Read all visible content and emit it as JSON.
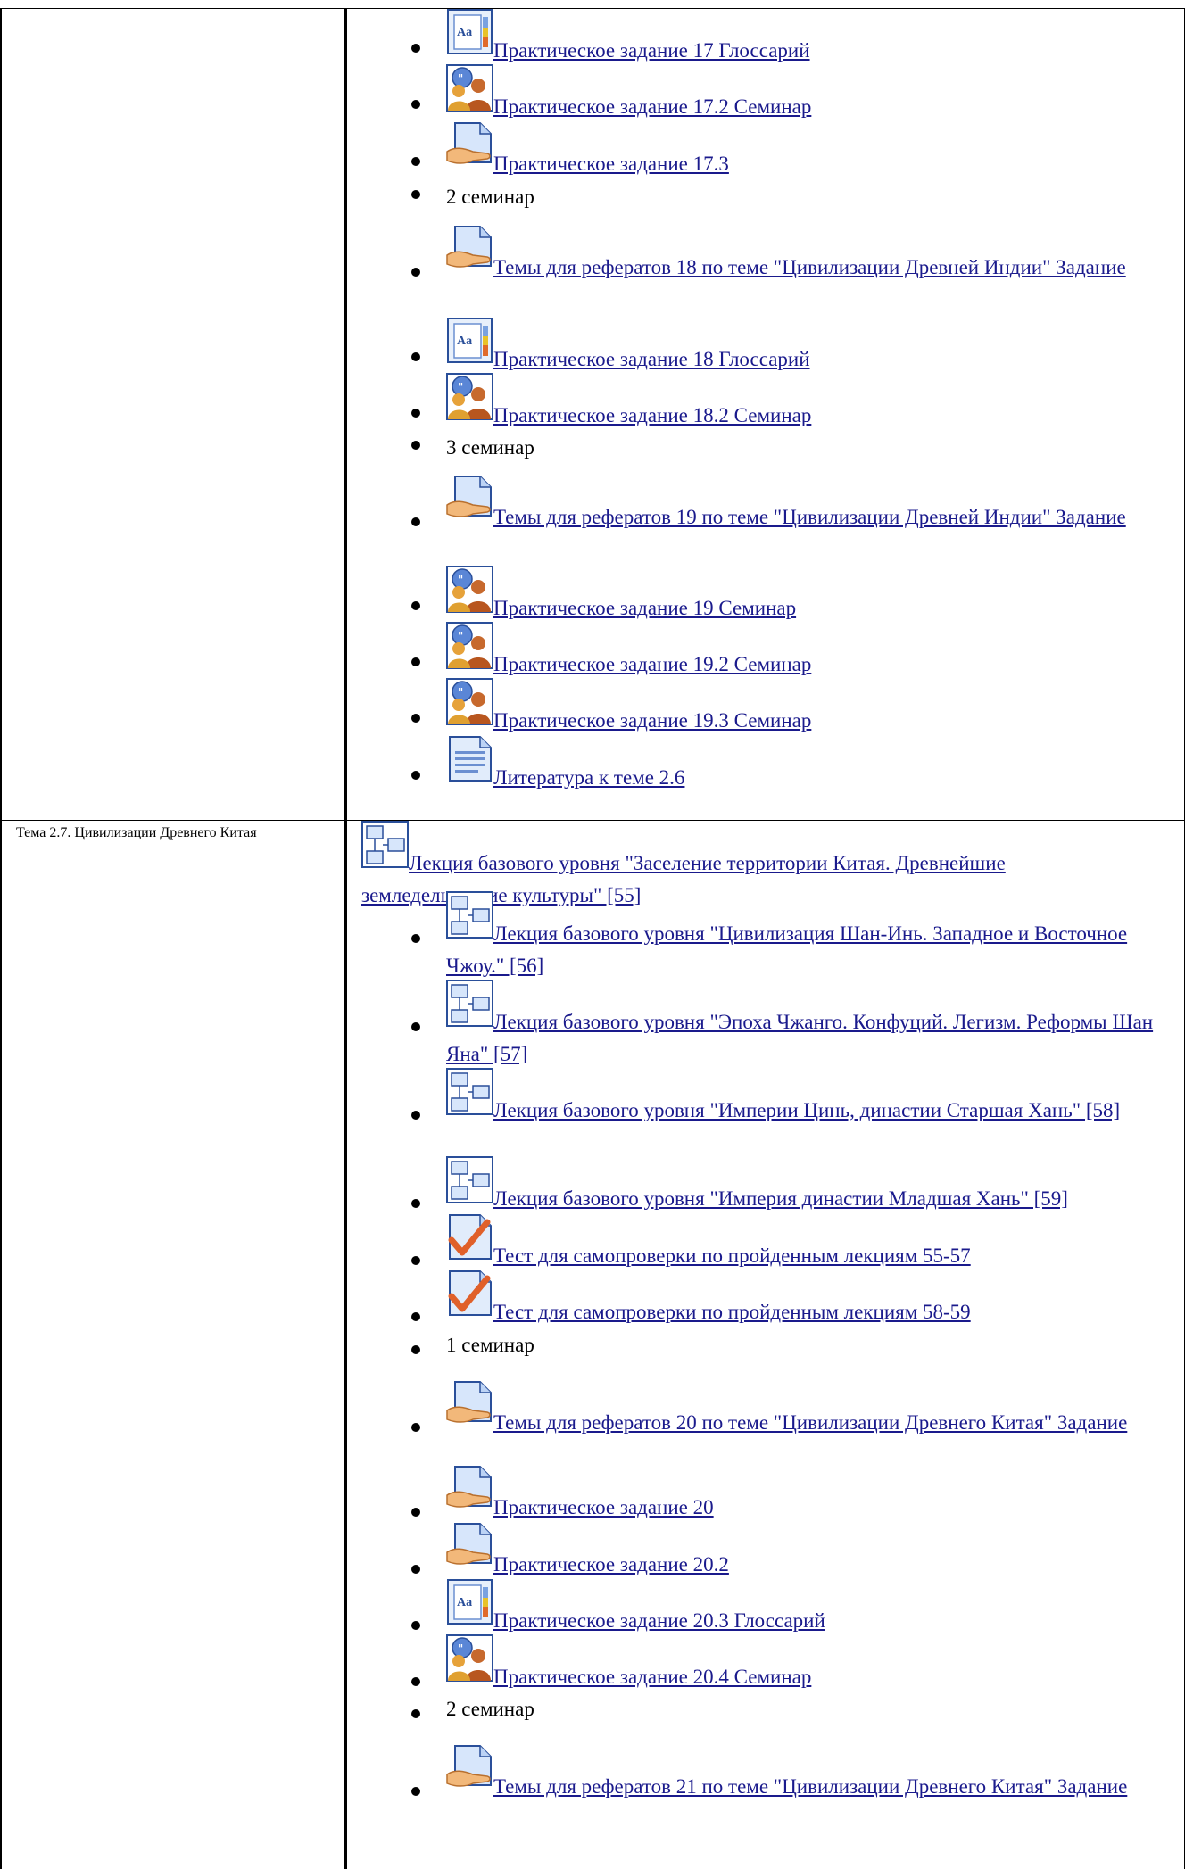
{
  "rows": [
    {
      "topic": "",
      "items": [
        {
          "kind": "link",
          "icon": "glossary-icon",
          "label": "Практическое задание 17 Глоссарий"
        },
        {
          "kind": "link",
          "icon": "seminar-icon",
          "label": "Практическое задание 17.2 Семинар"
        },
        {
          "kind": "link",
          "icon": "assignment-hand-icon",
          "label": "Практическое задание 17.3"
        },
        {
          "kind": "text",
          "label": "2 семинар"
        },
        {
          "kind": "link",
          "icon": "assignment-hand-icon",
          "label": "Темы для рефератов 18 по теме \"Цивилизации Древней Индии\" Задание"
        },
        {
          "kind": "link",
          "icon": "glossary-icon",
          "label": "Практическое задание 18 Глоссарий"
        },
        {
          "kind": "link",
          "icon": "seminar-icon",
          "label": "Практическое задание 18.2 Семинар"
        },
        {
          "kind": "text",
          "label": "3 семинар"
        },
        {
          "kind": "link",
          "icon": "assignment-hand-icon",
          "label": "Темы для рефератов 19 по теме \"Цивилизации Древней Индии\" Задание"
        },
        {
          "kind": "link",
          "icon": "seminar-icon",
          "label": "Практическое задание 19 Семинар"
        },
        {
          "kind": "link",
          "icon": "seminar-icon",
          "label": "Практическое задание 19.2 Семинар"
        },
        {
          "kind": "link",
          "icon": "seminar-icon",
          "label": "Практическое задание 19.3 Семинар"
        },
        {
          "kind": "link",
          "icon": "document-icon",
          "label": "Литература к теме 2.6"
        }
      ]
    },
    {
      "topic": "Тема 2.7. Цивилизации Древнего Китая",
      "lead": {
        "icon": "lesson-icon",
        "label": "Лекция базового уровня \"Заселение территории Китая. Древнейшие земледельческие культуры\" [55]"
      },
      "items": [
        {
          "kind": "link",
          "icon": "lesson-icon",
          "label": "Лекция базового уровня \"Цивилизация Шан-Инь. Западное и Восточное Чжоу.\" [56]"
        },
        {
          "kind": "link",
          "icon": "lesson-icon",
          "label": "Лекция базового уровня \"Эпоха Чжанго. Конфуций. Легизм. Реформы Шан Яна\" [57]"
        },
        {
          "kind": "link",
          "icon": "lesson-icon",
          "label": "Лекция базового уровня \"Империи Цинь, династии Старшая Хань\" [58]"
        },
        {
          "kind": "link",
          "icon": "lesson-icon",
          "label": "Лекция базового уровня \"Империя династии Младшая Хань\" [59]"
        },
        {
          "kind": "link",
          "icon": "quiz-check-icon",
          "label": "Тест для самопроверки по пройденным лекциям 55-57"
        },
        {
          "kind": "link",
          "icon": "quiz-check-icon",
          "label": "Тест для самопроверки по пройденным лекциям 58-59"
        },
        {
          "kind": "text",
          "label": "1 семинар"
        },
        {
          "kind": "link",
          "icon": "assignment-hand-icon",
          "label": "Темы для рефератов 20 по теме \"Цивилизации Древнего Китая\" Задание"
        },
        {
          "kind": "link",
          "icon": "assignment-hand-icon",
          "label": "Практическое задание 20"
        },
        {
          "kind": "link",
          "icon": "assignment-hand-icon",
          "label": "Практическое задание 20.2"
        },
        {
          "kind": "link",
          "icon": "glossary-icon",
          "label": "Практическое задание 20.3 Глоссарий"
        },
        {
          "kind": "link",
          "icon": "seminar-icon",
          "label": "Практическое задание 20.4 Семинар"
        },
        {
          "kind": "text",
          "label": "2 семинар"
        },
        {
          "kind": "link",
          "icon": "assignment-hand-icon",
          "label": "Темы для рефератов 21 по теме \"Цивилизации Древнего Китая\" Задание"
        }
      ]
    }
  ]
}
